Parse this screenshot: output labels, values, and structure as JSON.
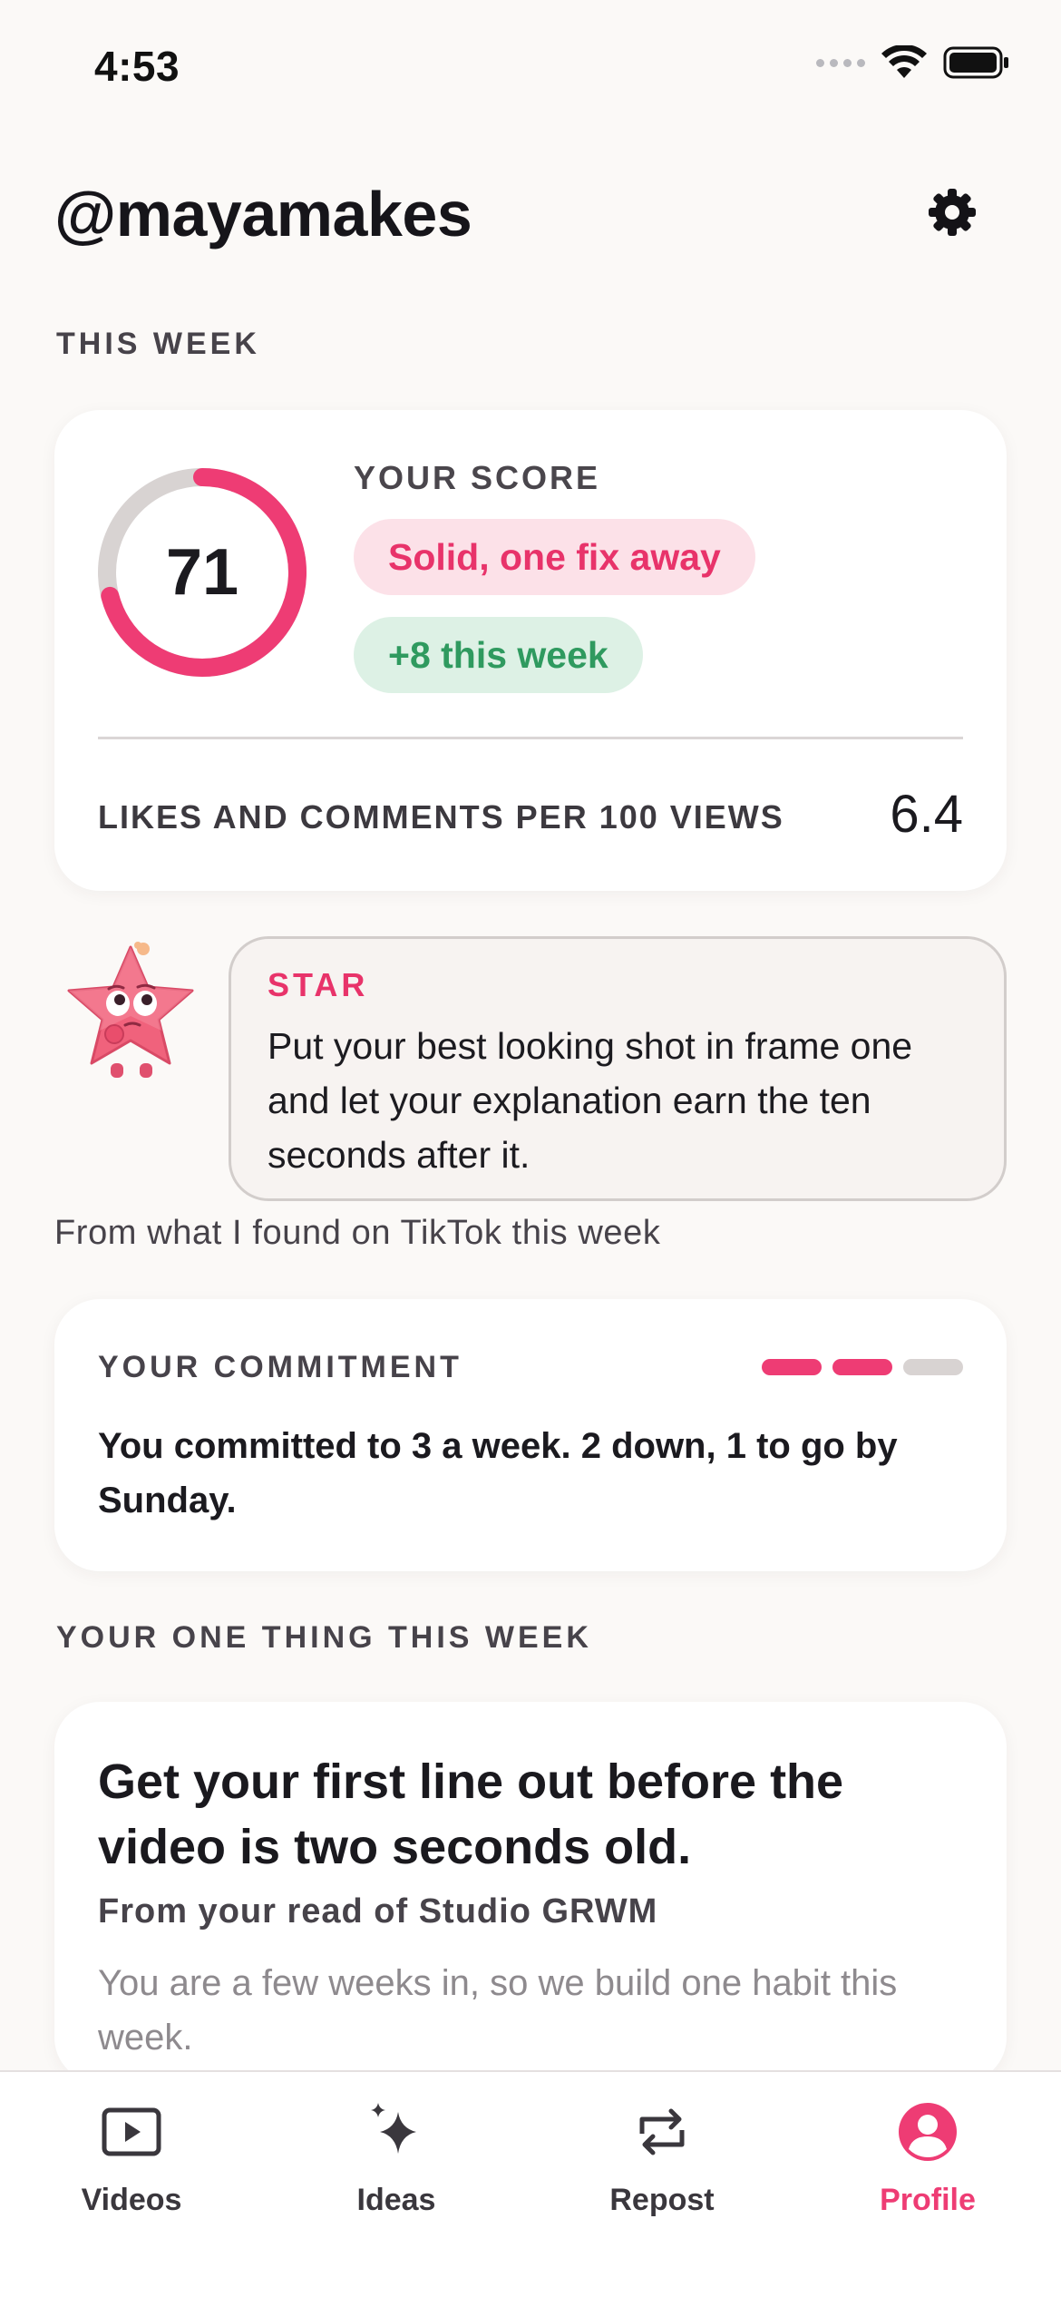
{
  "status_bar": {
    "time": "4:53"
  },
  "header": {
    "title": "@mayamakes"
  },
  "sections": {
    "this_week": "THIS WEEK",
    "one_thing": "YOUR ONE THING THIS WEEK"
  },
  "score_card": {
    "score": "71",
    "score_fraction": 0.71,
    "label": "YOUR SCORE",
    "verdict": "Solid, one fix away",
    "change": "+8 this week",
    "metric_label": "LIKES AND COMMENTS PER 100 VIEWS",
    "metric_value": "6.4"
  },
  "coach": {
    "name": "STAR",
    "message": "Put your best looking shot in frame one and let your explanation earn the ten seconds after it.",
    "source": "From what I found on TikTok this week"
  },
  "commitment": {
    "label": "YOUR COMMITMENT",
    "text": "You committed to 3 a week. 2 down, 1 to go by Sunday.",
    "completed": 2,
    "total": 3
  },
  "one_thing": {
    "title": "Get your first line out before the video is two seconds old.",
    "subtitle": "From your read of Studio GRWM",
    "body": "You are a few weeks in, so we build one habit this week."
  },
  "tabs": [
    {
      "label": "Videos",
      "icon": "play-square-icon",
      "active": false
    },
    {
      "label": "Ideas",
      "icon": "sparkles-icon",
      "active": false
    },
    {
      "label": "Repost",
      "icon": "repost-icon",
      "active": false
    },
    {
      "label": "Profile",
      "icon": "profile-icon",
      "active": true
    }
  ],
  "colors": {
    "accent": "#EE3C74",
    "positive": "#2F9A5F",
    "track": "#D8D3D2"
  }
}
